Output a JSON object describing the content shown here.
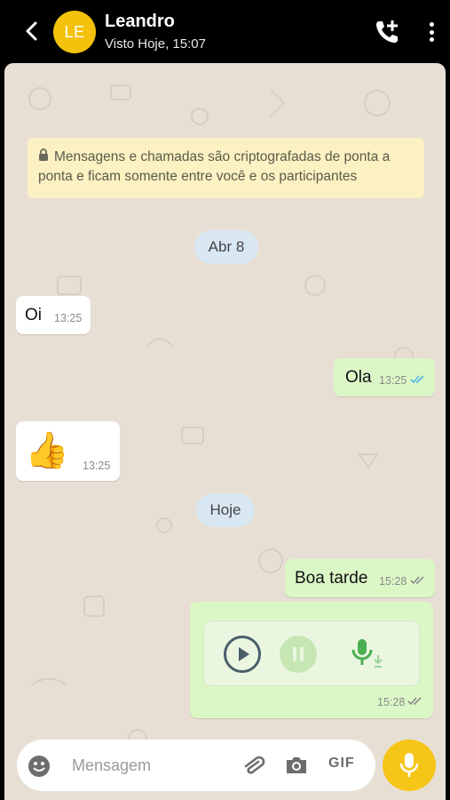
{
  "header": {
    "avatar_initials": "LE",
    "contact_name": "Leandro",
    "status": "Visto Hoje, 15:07",
    "icons": [
      "back-arrow-icon",
      "add-call-icon",
      "more-vert-icon"
    ]
  },
  "system_notice": "Mensagens e chamadas são criptografadas de ponta a ponta e ficam somente entre você e os participantes",
  "date_separators": [
    "Abr 8",
    "Hoje"
  ],
  "messages": [
    {
      "direction": "in",
      "text": "Oi",
      "time": "13:25"
    },
    {
      "direction": "out",
      "text": "Ola",
      "time": "13:25",
      "ticks": "read"
    },
    {
      "direction": "in",
      "text": "👍",
      "time": "13:25"
    },
    {
      "direction": "out",
      "text": "Boa tarde",
      "time": "15:28",
      "ticks": "delivered"
    },
    {
      "direction": "out",
      "type": "voice",
      "time": "15:28",
      "ticks": "delivered"
    }
  ],
  "composer": {
    "placeholder": "Mensagem",
    "gif_label": "GIF"
  },
  "colors": {
    "accent": "#f5c518",
    "outgoing_bubble": "#dbf7c6",
    "incoming_bubble": "#ffffff",
    "read_ticks": "#4fb3e8"
  }
}
